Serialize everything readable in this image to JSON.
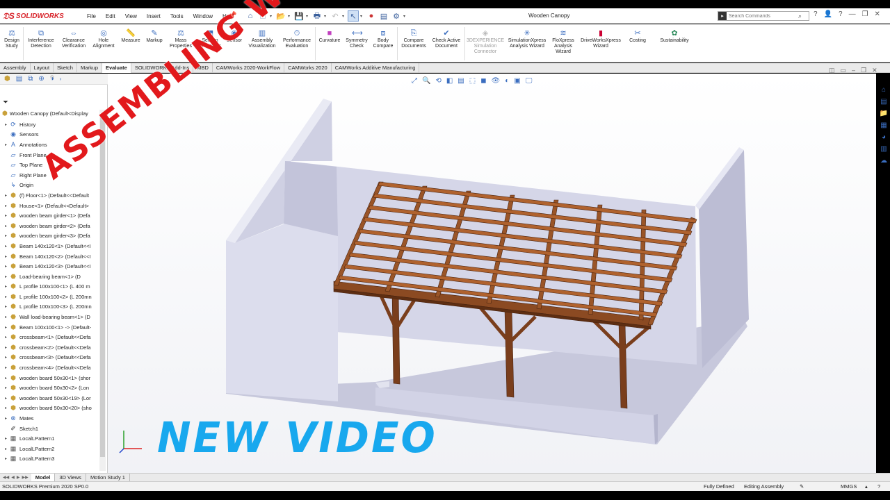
{
  "app": {
    "logo_text": "SOLIDWORKS",
    "document_title": "Wooden Canopy",
    "menu": [
      "File",
      "Edit",
      "View",
      "Insert",
      "Tools",
      "Window",
      "Help"
    ],
    "search_placeholder": "Search Commands"
  },
  "ribbon": {
    "evaluate_items": [
      {
        "label": "Design\nStudy",
        "icon": "design-study-icon"
      },
      {
        "label": "Interference\nDetection",
        "icon": "interference-icon"
      },
      {
        "label": "Clearance\nVerification",
        "icon": "clearance-icon"
      },
      {
        "label": "Hole\nAlignment",
        "icon": "hole-alignment-icon"
      },
      {
        "label": "Measure",
        "icon": "measure-icon"
      },
      {
        "label": "Markup",
        "icon": "markup-icon"
      },
      {
        "label": "Mass\nProperties",
        "icon": "mass-properties-icon"
      },
      {
        "label": "Section\nProperties",
        "icon": "section-properties-icon"
      },
      {
        "label": "Sensor",
        "icon": "sensor-icon"
      },
      {
        "label": "Assembly\nVisualization",
        "icon": "assembly-visualization-icon"
      },
      {
        "label": "Performance\nEvaluation",
        "icon": "performance-icon"
      },
      {
        "label": "Curvature",
        "icon": "curvature-icon"
      },
      {
        "label": "Symmetry\nCheck",
        "icon": "symmetry-icon"
      },
      {
        "label": "Body\nCompare",
        "icon": "body-compare-icon"
      },
      {
        "label": "Compare\nDocuments",
        "icon": "compare-documents-icon"
      },
      {
        "label": "Check Active\nDocument",
        "icon": "check-document-icon"
      },
      {
        "label": "3DEXPERIENCE\nSimulation\nConnector",
        "icon": "3dx-icon",
        "disabled": true
      },
      {
        "label": "SimulationXpress\nAnalysis Wizard",
        "icon": "simulationxpress-icon"
      },
      {
        "label": "FloXpress\nAnalysis\nWizard",
        "icon": "floxpress-icon"
      },
      {
        "label": "DriveWorksXpress\nWizard",
        "icon": "driveworks-icon"
      },
      {
        "label": "Costing",
        "icon": "costing-icon"
      },
      {
        "label": "Sustainability",
        "icon": "sustainability-icon"
      }
    ]
  },
  "command_tabs": [
    {
      "label": "Assembly"
    },
    {
      "label": "Layout"
    },
    {
      "label": "Sketch"
    },
    {
      "label": "Markup"
    },
    {
      "label": "Evaluate",
      "active": true
    },
    {
      "label": "SOLIDWORKS Add-Ins"
    },
    {
      "label": "MBD"
    },
    {
      "label": "CAMWorks 2020-WorkFlow"
    },
    {
      "label": "CAMWorks 2020"
    },
    {
      "label": "CAMWorks Additive Manufacturing"
    }
  ],
  "feature_tree": {
    "root": "Wooden Canopy  (Default<Display",
    "items": [
      {
        "label": "History",
        "icon": "history-icon",
        "expand": true
      },
      {
        "label": "Sensors",
        "icon": "sensors-icon",
        "expand": false
      },
      {
        "label": "Annotations",
        "icon": "annotations-icon",
        "expand": true
      },
      {
        "label": "Front Plane",
        "icon": "plane-icon",
        "expand": false
      },
      {
        "label": "Top Plane",
        "icon": "plane-icon",
        "expand": false
      },
      {
        "label": "Right Plane",
        "icon": "plane-icon",
        "expand": false
      },
      {
        "label": "Origin",
        "icon": "origin-icon",
        "expand": false
      },
      {
        "label": "(f) Floor<1> (Default<<Default",
        "icon": "part-icon",
        "expand": true
      },
      {
        "label": "House<1> (Default<<Default>",
        "icon": "part-icon",
        "expand": true
      },
      {
        "label": "wooden beam girder<1> (Defa",
        "icon": "part-icon",
        "expand": true
      },
      {
        "label": "wooden beam girder<2> (Defa",
        "icon": "part-icon",
        "expand": true
      },
      {
        "label": "wooden beam girder<3> (Defa",
        "icon": "part-icon",
        "expand": true
      },
      {
        "label": "Beam 140x120<1> (Default<<I",
        "icon": "part-icon",
        "expand": true
      },
      {
        "label": "Beam 140x120<2> (Default<<I",
        "icon": "part-icon",
        "expand": true
      },
      {
        "label": "Beam 140x120<3> (Default<<I",
        "icon": "part-icon",
        "expand": true
      },
      {
        "label": "Load-bearing beam<1> (D",
        "icon": "assembly-icon",
        "expand": true
      },
      {
        "label": "L profile 100x100<1> (L 400 m",
        "icon": "part-icon",
        "expand": true
      },
      {
        "label": "L profile 100x100<2> (L 200mn",
        "icon": "part-icon",
        "expand": true
      },
      {
        "label": "L profile 100x100<3> (L 200mn",
        "icon": "part-icon",
        "expand": true
      },
      {
        "label": "Wall load-bearing beam<1> (D",
        "icon": "assembly-icon",
        "expand": true
      },
      {
        "label": "Beam 100x100<1> -> (Default-",
        "icon": "part-icon",
        "expand": true
      },
      {
        "label": "crossbeam<1> (Default<<Defa",
        "icon": "part-icon",
        "expand": true
      },
      {
        "label": "crossbeam<2> (Default<<Defa",
        "icon": "part-icon",
        "expand": true
      },
      {
        "label": "crossbeam<3> (Default<<Defa",
        "icon": "part-icon",
        "expand": true
      },
      {
        "label": "crossbeam<4> (Default<<Defa",
        "icon": "part-icon",
        "expand": true
      },
      {
        "label": "wooden board 50x30<1> (shor",
        "icon": "part-icon",
        "expand": true
      },
      {
        "label": "wooden board 50x30<2> (Lon",
        "icon": "part-icon",
        "expand": true
      },
      {
        "label": "wooden board 50x30<19> (Lor",
        "icon": "part-icon",
        "expand": true
      },
      {
        "label": "wooden board 50x30<20> (sho",
        "icon": "part-icon",
        "expand": true
      },
      {
        "label": "Mates",
        "icon": "mates-icon",
        "expand": true
      },
      {
        "label": "Sketch1",
        "icon": "sketch-icon",
        "expand": false
      },
      {
        "label": "LocalLPattern1",
        "icon": "pattern-icon",
        "expand": true
      },
      {
        "label": "LocalLPattern2",
        "icon": "pattern-icon",
        "expand": true
      },
      {
        "label": "LocalLPattern3",
        "icon": "pattern-icon",
        "expand": true
      }
    ]
  },
  "bottom_tabs": [
    {
      "label": "Model",
      "active": true
    },
    {
      "label": "3D Views"
    },
    {
      "label": "Motion Study 1"
    }
  ],
  "status": {
    "product": "SOLIDWORKS Premium 2020 SP0.0",
    "state": "Fully Defined",
    "mode": "Editing Assembly",
    "units": "MMGS"
  },
  "overlay": {
    "diagonal": "ASSEMBLING WOODEN CANOPY",
    "bottom": "NEW VIDEO"
  },
  "colors": {
    "solidworks_red": "#d8232a",
    "overlay_red": "#e2191c",
    "overlay_blue": "#18a8ee",
    "wood": "#8b4a22",
    "wall": "#d6d7e8"
  }
}
